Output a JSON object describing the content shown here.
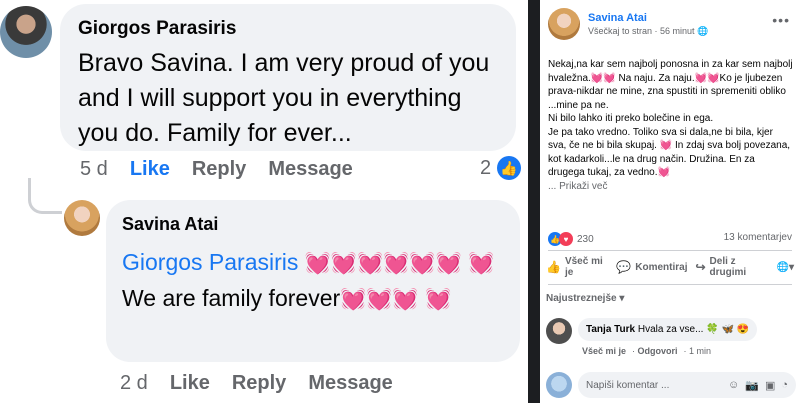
{
  "left": {
    "comment1": {
      "author": "Giorgos Parasiris",
      "text": "Bravo Savina. I am very proud of you and I will support you in everything you do. Family for ever...",
      "time": "5 d",
      "like": "Like",
      "reply": "Reply",
      "message": "Message",
      "reaction_count": "2"
    },
    "comment2": {
      "author": "Savina Atai",
      "mention": "Giorgos Parasiris",
      "text": "We are family forever",
      "time": "2 d",
      "like": "Like",
      "reply": "Reply",
      "message": "Message"
    }
  },
  "post": {
    "author": "Savina Atai",
    "audience": "Všečkaj to stran",
    "time": "56 minut",
    "body_lines": [
      "Nekaj,na kar sem najbolj ponosna in za kar sem najbolj hvaležna.💓💓 Na naju. Za naju.💓💓Ko je ljubezen prava-nikdar ne mine, zna spustiti in spremeniti obliko ...mine pa ne.",
      "Ni bilo lahko iti preko bolečine in ega.",
      "Je pa tako vredno. Toliko sva si dala,ne bi bila, kjer sva, če ne bi bila skupaj. 💓 In zdaj sva bolj povezana, kot kadarkoli...le na drug način. Družina. En za drugega tukaj, za vedno.💓"
    ],
    "see_more": "... Prikaži več",
    "reaction_count": "230",
    "comment_count": "13 komentarjev",
    "actions": {
      "like": "Všeč mi je",
      "comment": "Komentiraj",
      "share": "Deli z drugimi"
    },
    "sort": "Najustreznejše",
    "comment": {
      "author": "Tanja Turk",
      "text": "Hvala za vse...",
      "like": "Všeč mi je",
      "reply": "Odgovori",
      "time": "1 min"
    },
    "reply_placeholder": "Napiši komentar ..."
  },
  "colors": {
    "accent": "#1877f2",
    "bubble": "#f0f2f5",
    "secondary_text": "#65676b",
    "heart": "#ff4fa3"
  }
}
